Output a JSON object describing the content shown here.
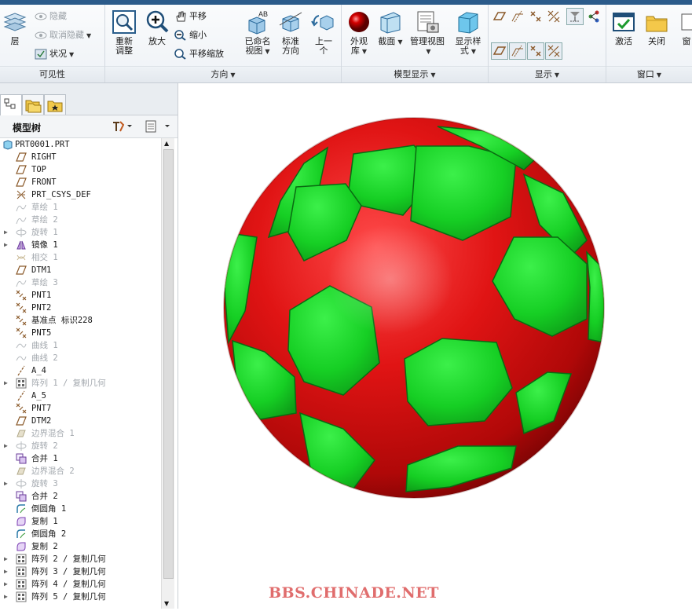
{
  "ribbon": {
    "visibility": {
      "layer": "层",
      "hide": "隐藏",
      "unhide": "取消隐藏",
      "status": "状况",
      "label": "可见性"
    },
    "orientation": {
      "refit": "重新\n调整",
      "zoom_in": "放大",
      "pan": "平移",
      "zoom_out": "缩小",
      "pan_zoom": "平移缩放",
      "named_views": "已命名\n视图",
      "standard": "标准\n方向",
      "previous": "上一\n个",
      "label": "方向"
    },
    "model_display": {
      "appearance": "外观\n库",
      "section": "截面",
      "manage_views": "管理视图",
      "display_style": "显示样\n式",
      "label": "模型显示"
    },
    "show": {
      "label": "显示"
    },
    "window": {
      "activate": "激活",
      "close": "关闭",
      "more": "窗",
      "label": "窗口"
    }
  },
  "model_tree": {
    "title": "模型树",
    "items": [
      {
        "text": "PRT0001.PRT",
        "icon": "part",
        "dim": false,
        "expand": false
      },
      {
        "text": "RIGHT",
        "icon": "datum-plane",
        "dim": false,
        "expand": false
      },
      {
        "text": "TOP",
        "icon": "datum-plane",
        "dim": false,
        "expand": false
      },
      {
        "text": "FRONT",
        "icon": "datum-plane",
        "dim": false,
        "expand": false
      },
      {
        "text": "PRT_CSYS_DEF",
        "icon": "csys",
        "dim": false,
        "expand": false
      },
      {
        "text": "草绘 1",
        "icon": "sketch",
        "dim": true,
        "expand": false
      },
      {
        "text": "草绘 2",
        "icon": "sketch",
        "dim": true,
        "expand": false
      },
      {
        "text": "旋转 1",
        "icon": "revolve",
        "dim": true,
        "expand": true
      },
      {
        "text": "镜像 1",
        "icon": "mirror",
        "dim": false,
        "expand": true
      },
      {
        "text": "相交 1",
        "icon": "intersect",
        "dim": true,
        "expand": false
      },
      {
        "text": "DTM1",
        "icon": "datum-plane",
        "dim": false,
        "expand": false
      },
      {
        "text": "草绘 3",
        "icon": "sketch",
        "dim": true,
        "expand": false
      },
      {
        "text": "PNT1",
        "icon": "point",
        "dim": false,
        "expand": false
      },
      {
        "text": "PNT2",
        "icon": "point",
        "dim": false,
        "expand": false
      },
      {
        "text": "基准点 标识228",
        "icon": "point",
        "dim": false,
        "expand": false
      },
      {
        "text": "PNT5",
        "icon": "point",
        "dim": false,
        "expand": false
      },
      {
        "text": "曲线 1",
        "icon": "curve",
        "dim": true,
        "expand": false
      },
      {
        "text": "曲线 2",
        "icon": "curve",
        "dim": true,
        "expand": false
      },
      {
        "text": "A_4",
        "icon": "axis",
        "dim": false,
        "expand": false
      },
      {
        "text": "阵列 1 / 复制几何",
        "icon": "pattern",
        "dim": true,
        "expand": true
      },
      {
        "text": "A_5",
        "icon": "axis",
        "dim": false,
        "expand": false
      },
      {
        "text": "PNT7",
        "icon": "point",
        "dim": false,
        "expand": false
      },
      {
        "text": "DTM2",
        "icon": "datum-plane",
        "dim": false,
        "expand": false
      },
      {
        "text": "边界混合 1",
        "icon": "blend",
        "dim": true,
        "expand": false
      },
      {
        "text": "旋转 2",
        "icon": "revolve",
        "dim": true,
        "expand": true
      },
      {
        "text": "合并 1",
        "icon": "merge",
        "dim": false,
        "expand": false
      },
      {
        "text": "边界混合 2",
        "icon": "blend",
        "dim": true,
        "expand": false
      },
      {
        "text": "旋转 3",
        "icon": "revolve",
        "dim": true,
        "expand": true
      },
      {
        "text": "合并 2",
        "icon": "merge",
        "dim": false,
        "expand": false
      },
      {
        "text": "倒圆角 1",
        "icon": "round",
        "dim": false,
        "expand": false
      },
      {
        "text": "复制 1",
        "icon": "copy",
        "dim": false,
        "expand": false
      },
      {
        "text": "倒圆角 2",
        "icon": "round",
        "dim": false,
        "expand": false
      },
      {
        "text": "复制 2",
        "icon": "copy",
        "dim": false,
        "expand": false
      },
      {
        "text": "阵列 2 / 复制几何",
        "icon": "pattern",
        "dim": false,
        "expand": true
      },
      {
        "text": "阵列 3 / 复制几何",
        "icon": "pattern",
        "dim": false,
        "expand": true
      },
      {
        "text": "阵列 4 / 复制几何",
        "icon": "pattern",
        "dim": false,
        "expand": true
      },
      {
        "text": "阵列 5 / 复制几何",
        "icon": "pattern",
        "dim": false,
        "expand": true
      }
    ]
  },
  "model": {
    "description_icon": "soccer-ball-model",
    "colors": {
      "red": "#e31b1b",
      "green": "#18d22a"
    }
  },
  "watermark": "BBS.CHINADE.NET"
}
